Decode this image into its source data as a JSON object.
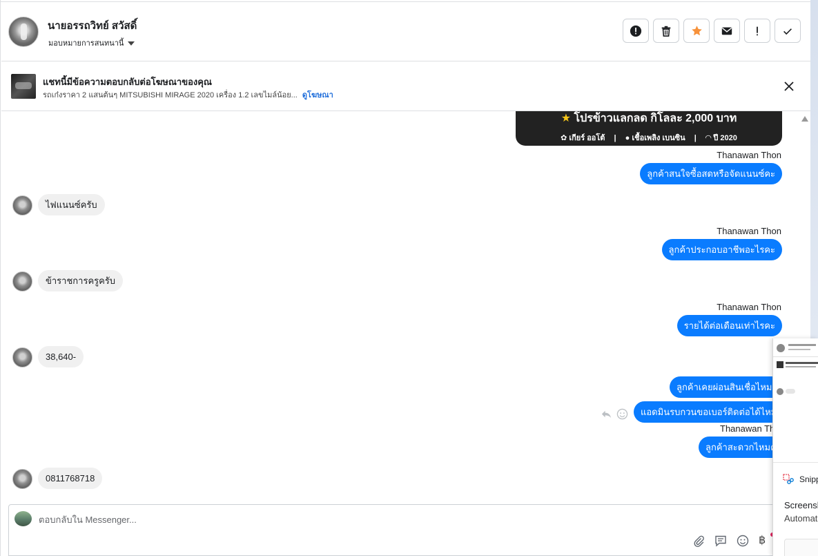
{
  "header": {
    "contact_name": "นายอรรถวิทย์ สวัสดิ์",
    "assign_label": "มอบหมายการสนทนานี้",
    "actions": [
      "mark-spam",
      "delete",
      "star",
      "mark-unread",
      "follow-up",
      "done"
    ]
  },
  "ad_banner": {
    "title": "แชทนี้มีข้อความตอบกลับต่อโฆษณาของคุณ",
    "description": "รถเก๋งราคา 2 แสนต้นๆ MITSUBISHI MIRAGE 2020 เครื่อง 1.2 เลขไมล์น้อย...",
    "link": "ดูโฆษณา"
  },
  "ad_card": {
    "promo": "โปรข้าวแลกลด กิโลละ 2,000 บาท",
    "spec_gear": "เกียร์ ออโต้",
    "spec_fuel": "เชื้อเพลิง เบนซิน",
    "spec_year": "ปี 2020"
  },
  "messages": {
    "sender_name": "Thanawan Thon",
    "sender_name_cut": "Thanawan Tho",
    "out1": "ลูกค้าสนใจซื้อสดหรือจัดแนนซ์คะ",
    "in1": "ไฟแนนซ์ครับ",
    "out2": "ลูกค้าประกอบอาชีพอะไรคะ",
    "in2": "ข้าราชการครูครับ",
    "out3": "รายได้ต่อเดือนเท่าไรคะ",
    "in3": "38,640-",
    "out4": "ลูกค้าเคยผ่อนสินเชื่อไหมคะ",
    "out5": "แอดมินรบกวนขอเบอร์ติดต่อได้ไหมคะ",
    "out6": "ลูกค้าสะดวกไหมคะ",
    "in4": "0811768718"
  },
  "composer": {
    "placeholder": "ตอบกลับใน Messenger...",
    "currency_icon": "฿"
  },
  "notification": {
    "app": "Snipping Tool",
    "line1": "Screenshot copied to clipboard",
    "line2": "Automatically saved to screenshots folder"
  }
}
